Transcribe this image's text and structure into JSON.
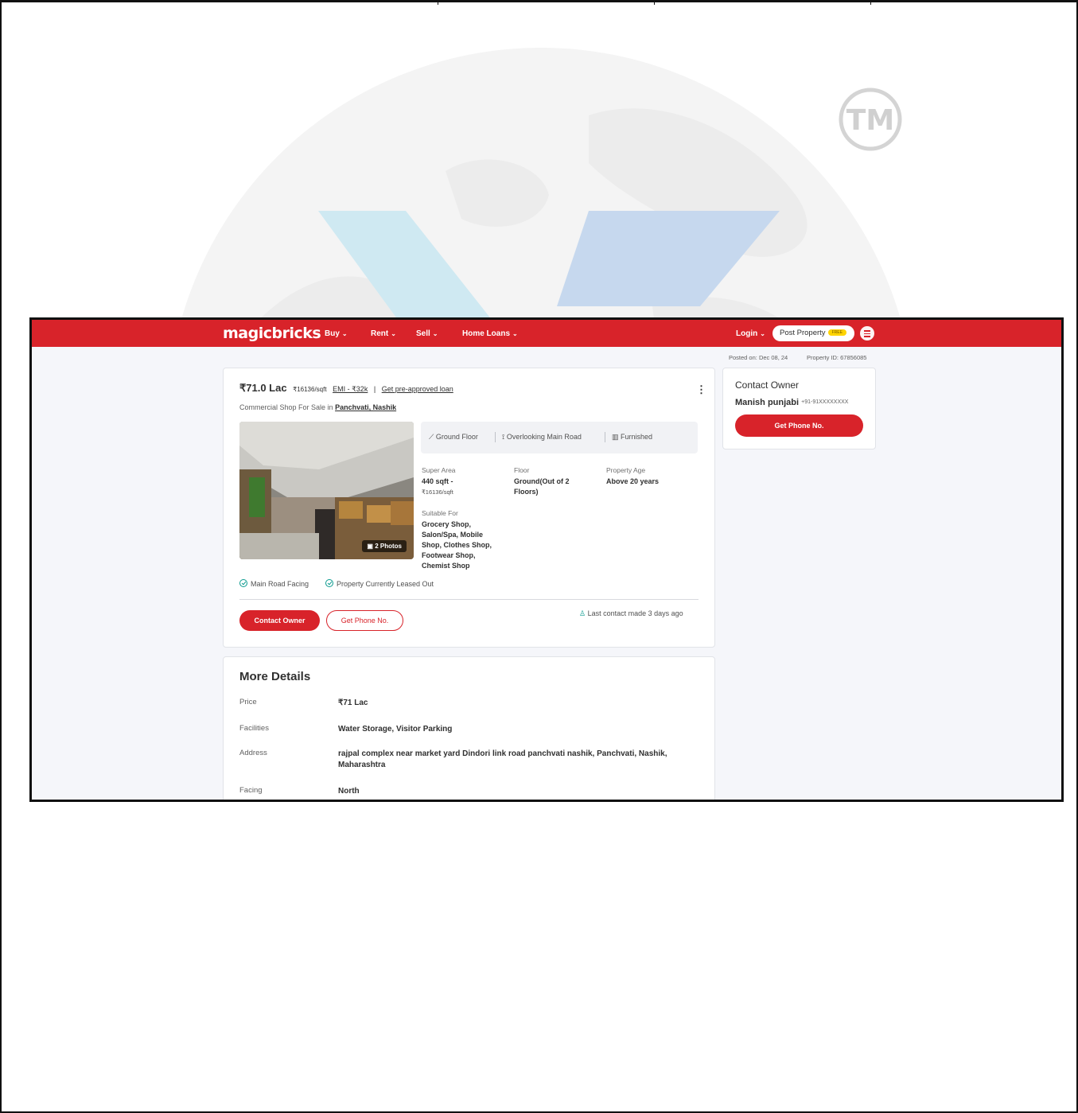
{
  "nav": {
    "logo": "magicbricks",
    "items": [
      "Buy",
      "Rent",
      "Sell",
      "Home Loans"
    ],
    "login": "Login",
    "post_property": "Post Property",
    "free_badge": "FREE"
  },
  "meta": {
    "posted_on": "Posted on: Dec 08, 24",
    "property_id": "Property ID: 67856085"
  },
  "listing": {
    "price": "₹71.0 Lac",
    "price_per_sqft": "₹16136/sqft",
    "emi": "EMI - ₹32k",
    "separator": "|",
    "loan_link": "Get pre-approved loan",
    "subtitle_prefix": "Commercial Shop For Sale in",
    "locality": "Panchvati, Nashik",
    "photos_badge": "2 Photos",
    "summary": [
      "Ground Floor",
      "Overlooking Main Road",
      "Furnished"
    ],
    "attributes": {
      "super_area_label": "Super Area",
      "super_area_value": "440 sqft -",
      "super_area_rate": "₹16136/sqft",
      "floor_label": "Floor",
      "floor_value": "Ground(Out of 2 Floors)",
      "age_label": "Property Age",
      "age_value": "Above 20 years",
      "suitable_label": "Suitable For",
      "suitable_value": "Grocery Shop, Salon/Spa, Mobile Shop, Clothes Shop, Footwear Shop, Chemist Shop"
    },
    "tags": [
      "Main Road Facing",
      "Property Currently Leased Out"
    ],
    "contact_owner_btn": "Contact Owner",
    "get_phone_btn": "Get Phone No.",
    "last_contact": "Last contact made 3 days ago"
  },
  "more_details": {
    "title": "More Details",
    "rows": [
      {
        "label": "Price",
        "value": "₹71 Lac"
      },
      {
        "label": "Facilities",
        "value": "Water Storage, Visitor Parking"
      },
      {
        "label": "Address",
        "value": "rajpal complex near market yard Dindori link road panchvati nashik, Panchvati, Nashik, Maharashtra"
      },
      {
        "label": "Facing",
        "value": "North"
      }
    ]
  },
  "contact_card": {
    "title": "Contact Owner",
    "name": "Manish punjabi",
    "phone": "+91-91XXXXXXXX",
    "button": "Get Phone No."
  },
  "colors": {
    "brand_red": "#d8232a",
    "accent_teal": "#0a9a8e",
    "page_bg": "#f5f6fa"
  },
  "watermark": {
    "mark": "TM"
  }
}
